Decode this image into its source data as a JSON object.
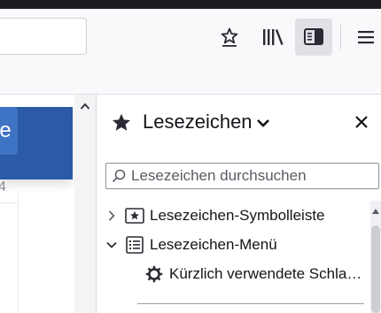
{
  "page": {
    "card_button_text": "e",
    "fragment_text": "4"
  },
  "toolbar": {
    "icons": [
      "bookmark-star-icon",
      "library-icon",
      "sidebar-icon",
      "menu-icon"
    ]
  },
  "sidebar": {
    "title": "Lesezeichen",
    "search_placeholder": "Lesezeichen durchsuchen",
    "items": [
      {
        "label": "Lesezeichen-Symbolleiste",
        "expanded": false,
        "icon": "bookmarks-toolbar-icon"
      },
      {
        "label": "Lesezeichen-Menü",
        "expanded": true,
        "icon": "bookmarks-menu-icon"
      },
      {
        "label": "Kürzlich verwendete Schla…",
        "icon": "gear-icon"
      }
    ]
  },
  "colors": {
    "accent_blue": "#2a5aa8",
    "top_strip": "#1c1b22",
    "active_button": "#e0e0e6"
  }
}
